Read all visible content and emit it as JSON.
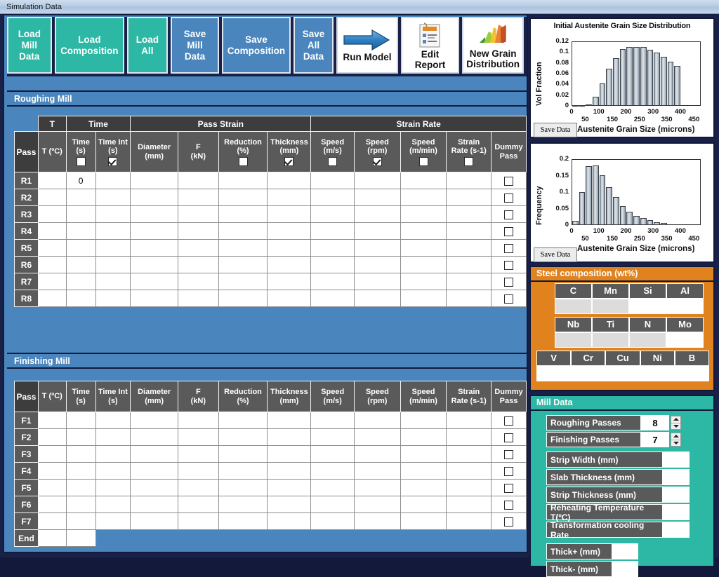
{
  "window": {
    "title": "Simulation Data"
  },
  "toolbar": {
    "buttons": [
      {
        "label": "Load\nMill\nData",
        "style": "teal",
        "name": "load-mill-data-button"
      },
      {
        "label": "Load\nComposition",
        "style": "teal",
        "name": "load-composition-button"
      },
      {
        "label": "Load\nAll",
        "style": "teal",
        "name": "load-all-button"
      },
      {
        "label": "Save\nMill\nData",
        "style": "blue",
        "name": "save-mill-data-button"
      },
      {
        "label": "Save\nComposition",
        "style": "blue",
        "name": "save-composition-button"
      },
      {
        "label": "Save\nAll\nData",
        "style": "blue",
        "name": "save-all-data-button"
      },
      {
        "label": "Run Model",
        "style": "white",
        "icon": "blue-arrow-icon",
        "name": "run-model-button"
      },
      {
        "label": "Edit Report",
        "style": "white",
        "icon": "report-document-icon",
        "name": "edit-report-button"
      },
      {
        "label": "New Grain\nDistribution",
        "style": "white",
        "icon": "bar-chart-icon",
        "name": "new-grain-distribution-button"
      }
    ]
  },
  "roughing": {
    "section_title": "Roughing Mill",
    "group_headers": [
      {
        "label": "",
        "span": 1
      },
      {
        "label": "T",
        "span": 1
      },
      {
        "label": "Time",
        "span": 2
      },
      {
        "label": "Pass Strain",
        "span": 4
      },
      {
        "label": "Strain Rate",
        "span": 5
      }
    ],
    "columns": [
      {
        "line1": "Pass",
        "line2": "",
        "checkbox": null
      },
      {
        "line1": "T (ºC)",
        "line2": "",
        "checkbox": null
      },
      {
        "line1": "Time",
        "line2": "(s)",
        "checkbox": false
      },
      {
        "line1": "Time Int",
        "line2": "(s)",
        "checkbox": true
      },
      {
        "line1": "Diameter",
        "line2": "(mm)",
        "checkbox": null
      },
      {
        "line1": "F",
        "line2": "(kN)",
        "checkbox": null
      },
      {
        "line1": "Reduction",
        "line2": "(%)",
        "checkbox": false
      },
      {
        "line1": "Thickness",
        "line2": "(mm)",
        "checkbox": true
      },
      {
        "line1": "Speed",
        "line2": "(m/s)",
        "checkbox": false
      },
      {
        "line1": "Speed",
        "line2": "(rpm)",
        "checkbox": true
      },
      {
        "line1": "Speed",
        "line2": "(m/min)",
        "checkbox": false
      },
      {
        "line1": "Strain",
        "line2": "Rate (s-1)",
        "checkbox": false
      },
      {
        "line1": "Dummy",
        "line2": "Pass",
        "checkbox": null
      }
    ],
    "rows": [
      {
        "pass": "R1",
        "values": [
          "",
          "0",
          "",
          "",
          "",
          "",
          "",
          "",
          "",
          "",
          ""
        ],
        "dummy": false
      },
      {
        "pass": "R2",
        "values": [
          "",
          "",
          "",
          "",
          "",
          "",
          "",
          "",
          "",
          "",
          ""
        ],
        "dummy": false
      },
      {
        "pass": "R3",
        "values": [
          "",
          "",
          "",
          "",
          "",
          "",
          "",
          "",
          "",
          "",
          ""
        ],
        "dummy": false
      },
      {
        "pass": "R4",
        "values": [
          "",
          "",
          "",
          "",
          "",
          "",
          "",
          "",
          "",
          "",
          ""
        ],
        "dummy": false
      },
      {
        "pass": "R5",
        "values": [
          "",
          "",
          "",
          "",
          "",
          "",
          "",
          "",
          "",
          "",
          ""
        ],
        "dummy": false
      },
      {
        "pass": "R6",
        "values": [
          "",
          "",
          "",
          "",
          "",
          "",
          "",
          "",
          "",
          "",
          ""
        ],
        "dummy": false
      },
      {
        "pass": "R7",
        "values": [
          "",
          "",
          "",
          "",
          "",
          "",
          "",
          "",
          "",
          "",
          ""
        ],
        "dummy": false
      },
      {
        "pass": "R8",
        "values": [
          "",
          "",
          "",
          "",
          "",
          "",
          "",
          "",
          "",
          "",
          ""
        ],
        "dummy": false
      }
    ]
  },
  "finishing": {
    "section_title": "Finishing Mill",
    "columns": [
      {
        "line1": "Pass",
        "line2": ""
      },
      {
        "line1": "T (ºC)",
        "line2": ""
      },
      {
        "line1": "Time",
        "line2": "(s)"
      },
      {
        "line1": "Time Int",
        "line2": "(s)"
      },
      {
        "line1": "Diameter",
        "line2": "(mm)"
      },
      {
        "line1": "F",
        "line2": "(kN)"
      },
      {
        "line1": "Reduction",
        "line2": "(%)"
      },
      {
        "line1": "Thickness",
        "line2": "(mm)"
      },
      {
        "line1": "Speed",
        "line2": "(m/s)"
      },
      {
        "line1": "Speed",
        "line2": "(rpm)"
      },
      {
        "line1": "Speed",
        "line2": "(m/min)"
      },
      {
        "line1": "Strain",
        "line2": "Rate (s-1)"
      },
      {
        "line1": "Dummy",
        "line2": "Pass"
      }
    ],
    "rows": [
      {
        "pass": "F1",
        "values": [
          "",
          "",
          "",
          "",
          "",
          "",
          "",
          "",
          "",
          "",
          ""
        ],
        "dummy": false,
        "short": false
      },
      {
        "pass": "F2",
        "values": [
          "",
          "",
          "",
          "",
          "",
          "",
          "",
          "",
          "",
          "",
          ""
        ],
        "dummy": false,
        "short": false
      },
      {
        "pass": "F3",
        "values": [
          "",
          "",
          "",
          "",
          "",
          "",
          "",
          "",
          "",
          "",
          ""
        ],
        "dummy": false,
        "short": false
      },
      {
        "pass": "F4",
        "values": [
          "",
          "",
          "",
          "",
          "",
          "",
          "",
          "",
          "",
          "",
          ""
        ],
        "dummy": false,
        "short": false
      },
      {
        "pass": "F5",
        "values": [
          "",
          "",
          "",
          "",
          "",
          "",
          "",
          "",
          "",
          "",
          ""
        ],
        "dummy": false,
        "short": false
      },
      {
        "pass": "F6",
        "values": [
          "",
          "",
          "",
          "",
          "",
          "",
          "",
          "",
          "",
          "",
          ""
        ],
        "dummy": false,
        "short": false
      },
      {
        "pass": "F7",
        "values": [
          "",
          "",
          "",
          "",
          "",
          "",
          "",
          "",
          "",
          "",
          ""
        ],
        "dummy": false,
        "short": false
      },
      {
        "pass": "End",
        "values": [
          "",
          "",
          "",
          "",
          "",
          "",
          "",
          "",
          "",
          "",
          ""
        ],
        "dummy": null,
        "short": true
      }
    ]
  },
  "charts": {
    "save_label": "Save Data"
  },
  "chart_data": [
    {
      "type": "bar",
      "title": "Initial Austenite Grain Size Distribution",
      "xlabel": "Austenite Grain Size (microns)",
      "ylabel": "Vol Fraction",
      "ylim": [
        0,
        0.12
      ],
      "xlim": [
        0,
        475
      ],
      "yticks": [
        "0",
        "0.02",
        "0.04",
        "0.06",
        "0.08",
        "0.1",
        "0.12"
      ],
      "ytick_values": [
        0,
        0.02,
        0.04,
        0.06,
        0.08,
        0.1,
        0.12
      ],
      "xticks": [
        "0",
        "50",
        "100",
        "150",
        "200",
        "250",
        "300",
        "350",
        "400",
        "450"
      ],
      "xtick_values": [
        0,
        50,
        100,
        150,
        200,
        250,
        300,
        350,
        400,
        450
      ],
      "grid": false,
      "legend": "none",
      "categories": [
        25,
        50,
        75,
        100,
        125,
        150,
        175,
        200,
        225,
        250,
        275,
        300,
        325,
        350,
        375,
        400,
        425,
        450
      ],
      "values": [
        0.001,
        0.001,
        0.003,
        0.017,
        0.042,
        0.069,
        0.089,
        0.106,
        0.109,
        0.11,
        0.11,
        0.105,
        0.099,
        0.091,
        0.082,
        0.075,
        0.0,
        0.0
      ]
    },
    {
      "type": "bar",
      "title": "",
      "xlabel": "Austenite Grain Size (microns)",
      "ylabel": "Frequency",
      "ylim": [
        0,
        0.2
      ],
      "xlim": [
        0,
        475
      ],
      "yticks": [
        "0",
        "0.05",
        "0.1",
        "0.15",
        "0.2"
      ],
      "ytick_values": [
        0,
        0.05,
        0.1,
        0.15,
        0.2
      ],
      "xticks": [
        "0",
        "50",
        "100",
        "150",
        "200",
        "250",
        "300",
        "350",
        "400",
        "450"
      ],
      "xtick_values": [
        0,
        50,
        100,
        150,
        200,
        250,
        300,
        350,
        400,
        450
      ],
      "grid": false,
      "legend": "none",
      "categories": [
        25,
        50,
        75,
        100,
        125,
        150,
        175,
        200,
        225,
        250,
        275,
        300,
        325,
        350,
        375,
        400,
        425,
        450
      ],
      "values": [
        0.012,
        0.1,
        0.178,
        0.18,
        0.151,
        0.114,
        0.085,
        0.057,
        0.04,
        0.028,
        0.021,
        0.014,
        0.009,
        0.007,
        0.0,
        0.0,
        0.0,
        0.0
      ]
    }
  ],
  "steel": {
    "title": "Steel composition (wt%)",
    "rows": [
      {
        "elements": [
          "C",
          "Mn",
          "Si",
          "Al"
        ],
        "disabled": [
          true,
          true,
          false,
          false
        ]
      },
      {
        "elements": [
          "Nb",
          "Ti",
          "N",
          "Mo"
        ],
        "disabled": [
          true,
          true,
          true,
          false
        ]
      },
      {
        "elements": [
          "V",
          "Cr",
          "Cu",
          "Ni",
          "B"
        ],
        "disabled": [
          false,
          false,
          false,
          false,
          false
        ]
      }
    ]
  },
  "mill": {
    "title": "Mill Data",
    "spinners": [
      {
        "label": "Roughing Passes",
        "value": "8"
      },
      {
        "label": "Finishing Passes",
        "value": "7"
      }
    ],
    "fields": [
      {
        "label": "Strip Width (mm)",
        "value": ""
      },
      {
        "label": "Slab Thickness (mm)",
        "value": ""
      },
      {
        "label": "Strip Thickness (mm)",
        "value": ""
      },
      {
        "label": "Reheating Temperature T(ºC)",
        "value": ""
      },
      {
        "label": "Transformation cooling Rate",
        "value": ""
      }
    ],
    "thickness": [
      {
        "label": "Thick+ (mm)",
        "value": ""
      },
      {
        "label": "Thick- (mm)",
        "value": ""
      }
    ]
  },
  "colors": {
    "teal": "#2cb8a4",
    "blue": "#4a86bd",
    "orange": "#e0821e",
    "darknavy": "#192047",
    "headergray": "#5a5a5a"
  }
}
